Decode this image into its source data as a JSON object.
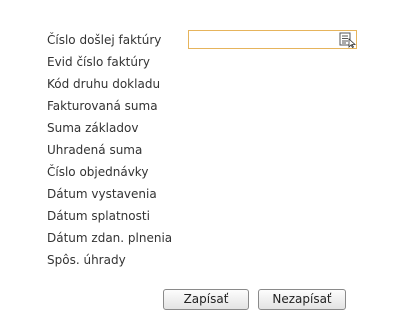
{
  "form": {
    "fields": [
      {
        "label": "Číslo došlej faktúry"
      },
      {
        "label": "Evid číslo faktúry"
      },
      {
        "label": "Kód druhu dokladu"
      },
      {
        "label": "Fakturovaná suma"
      },
      {
        "label": "Suma základov"
      },
      {
        "label": "Uhradená suma"
      },
      {
        "label": "Číslo objednávky"
      },
      {
        "label": "Dátum vystavenia"
      },
      {
        "label": "Dátum splatnosti"
      },
      {
        "label": "Dátum zdan. plnenia"
      },
      {
        "label": "Spôs. úhrady"
      }
    ],
    "invoice_number_input": {
      "value": "",
      "placeholder": ""
    },
    "lookup_icon": "list-lookup-icon",
    "input_border_color": "#e6b45c"
  },
  "actions": {
    "save_label": "Zapísať",
    "cancel_label": "Nezapísať"
  }
}
